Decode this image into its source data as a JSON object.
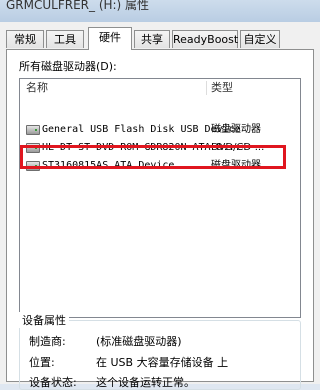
{
  "window": {
    "title": "GRMCULFRER_ (H:) 属性"
  },
  "tabs": [
    {
      "label": "常规"
    },
    {
      "label": "工具"
    },
    {
      "label": "硬件"
    },
    {
      "label": "共享"
    },
    {
      "label": "ReadyBoost"
    },
    {
      "label": "自定义"
    }
  ],
  "active_tab": "硬件",
  "devices_section": {
    "label": "所有磁盘驱动器(D):",
    "columns": {
      "name": "名称",
      "type": "类型"
    },
    "rows": [
      {
        "name": "General USB Flash Disk USB Device",
        "type": "磁盘驱动器",
        "highlighted": true
      },
      {
        "name": "HL-DT-ST DVD-ROM GDR820N ATA D...",
        "type": "DVD/CD-..."
      },
      {
        "name": "ST3160815AS ATA Device",
        "type": "磁盘驱动器"
      }
    ]
  },
  "properties": {
    "title": "设备属性",
    "manufacturer_label": "制造商:",
    "manufacturer_value": "(标准磁盘驱动器)",
    "location_label": "位置:",
    "location_value": "在 USB 大容量存储设备 上",
    "status_label": "设备状态:",
    "status_value": "这个设备运转正常。"
  },
  "colors": {
    "highlight_border": "#e0161f",
    "titlebar": "#c4d6ea"
  }
}
